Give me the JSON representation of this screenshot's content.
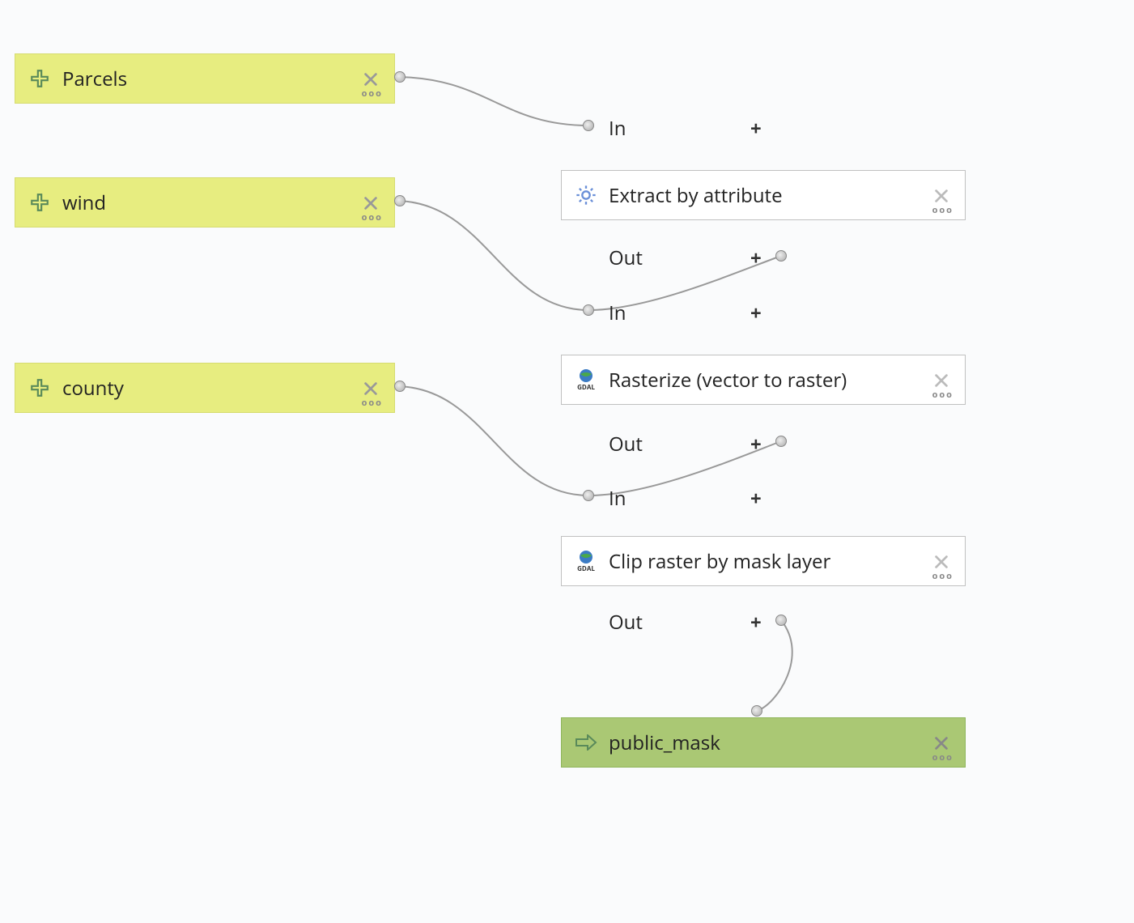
{
  "inputs": {
    "parcels": {
      "label": "Parcels"
    },
    "wind": {
      "label": "wind"
    },
    "county": {
      "label": "county"
    }
  },
  "processes": {
    "extract": {
      "label": "Extract by attribute",
      "icon": "gear"
    },
    "rasterize": {
      "label": "Rasterize (vector to raster)",
      "icon": "gdal"
    },
    "clip": {
      "label": "Clip raster by mask layer",
      "icon": "gdal"
    }
  },
  "output": {
    "public_mask": {
      "label": "public_mask"
    }
  },
  "ports": {
    "in": "In",
    "out": "Out",
    "plus": "+"
  },
  "menu": "ooo"
}
